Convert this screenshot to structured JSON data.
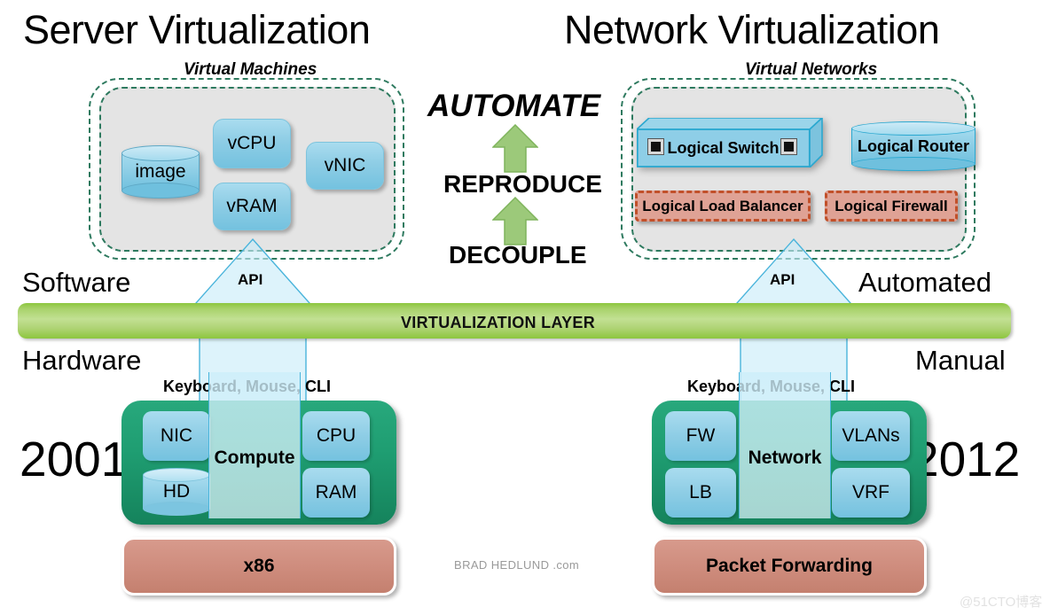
{
  "titles": {
    "left": "Server Virtualization",
    "right": "Network Virtualization"
  },
  "subtitles": {
    "left": "Virtual Machines",
    "right": "Virtual Networks"
  },
  "vm_components": [
    {
      "label": "image",
      "shape": "cylinder"
    },
    {
      "label": "vCPU",
      "shape": "rounded-box"
    },
    {
      "label": "vRAM",
      "shape": "rounded-box"
    },
    {
      "label": "vNIC",
      "shape": "rounded-box"
    }
  ],
  "vnet_components": [
    {
      "label": "Logical Switch",
      "shape": "switch3d"
    },
    {
      "label": "Logical Router",
      "shape": "cylinder"
    },
    {
      "label": "Logical Load Balancer",
      "shape": "dashed-box"
    },
    {
      "label": "Logical Firewall",
      "shape": "dashed-box"
    }
  ],
  "center": {
    "automate": "AUTOMATE",
    "reproduce": "REPRODUCE",
    "decouple": "DECOUPLE"
  },
  "layer": {
    "bar_label": "VIRTUALIZATION LAYER",
    "left_above": "Software",
    "left_below": "Hardware",
    "right_above": "Automated",
    "right_below": "Manual",
    "api_left": "API",
    "api_right": "API"
  },
  "stacks": {
    "left": {
      "year": "2001",
      "input_label": "Keyboard, Mouse, CLI",
      "center_label": "Compute",
      "components": [
        "NIC",
        "CPU",
        "HD",
        "RAM"
      ],
      "base_label": "x86"
    },
    "right": {
      "year": "2012",
      "input_label": "Keyboard, Mouse, CLI",
      "center_label": "Network",
      "components": [
        "FW",
        "VLANs",
        "LB",
        "VRF"
      ],
      "base_label": "Packet Forwarding"
    }
  },
  "credit": "BRAD HEDLUND .com",
  "watermark": "@51CTO博客",
  "colors": {
    "green_bar": "#8cc63e",
    "green_arrow": "#90c46a",
    "teal_hw": "#1f9e72",
    "blue_component": "#8ecde5",
    "salmon": "#cf8d7e",
    "dash_green": "#2e7a5f",
    "dash_orange": "#c1502a"
  }
}
